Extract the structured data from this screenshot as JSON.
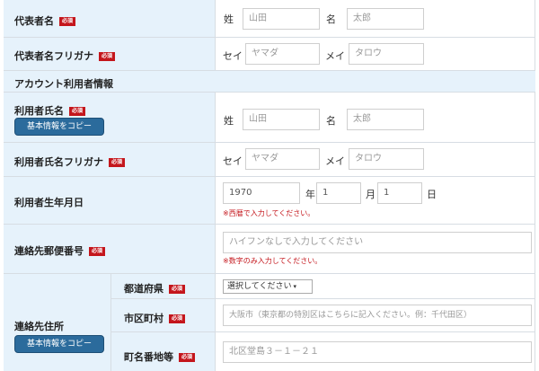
{
  "required": "必須",
  "representative": {
    "name_label": "代表者名",
    "name_sei_label": "姓",
    "name_sei_placeholder": "山田",
    "name_mei_label": "名",
    "name_mei_placeholder": "太郎",
    "kana_label": "代表者名フリガナ",
    "kana_sei_label": "セイ",
    "kana_sei_placeholder": "ヤマダ",
    "kana_mei_label": "メイ",
    "kana_mei_placeholder": "タロウ"
  },
  "section_title": "アカウント利用者情報",
  "user": {
    "name_label": "利用者氏名",
    "copy_button": "基本情報をコピー",
    "name_sei_label": "姓",
    "name_sei_placeholder": "山田",
    "name_mei_label": "名",
    "name_mei_placeholder": "太郎",
    "kana_label": "利用者氏名フリガナ",
    "kana_sei_label": "セイ",
    "kana_sei_placeholder": "ヤマダ",
    "kana_mei_label": "メイ",
    "kana_mei_placeholder": "タロウ",
    "birth_label": "利用者生年月日",
    "birth_year": "1970",
    "year_suffix": "年",
    "birth_month": "1",
    "month_suffix": "月",
    "birth_day": "1",
    "day_suffix": "日",
    "birth_note": "※西暦で入力してください。"
  },
  "contact": {
    "zip_label": "連絡先郵便番号",
    "zip_placeholder": "ハイフンなしで入力してください",
    "zip_note": "※数字のみ入力してください。",
    "address_label": "連絡先住所",
    "copy_button": "基本情報をコピー",
    "pref_label": "都道府県",
    "pref_value": "選択してください",
    "city_label": "市区町村",
    "city_placeholder": "大阪市（東京都の特別区はこちらに記入ください。例：千代田区）",
    "street_label": "町名番地等",
    "street_placeholder": "北区堂島３－１－２１"
  }
}
